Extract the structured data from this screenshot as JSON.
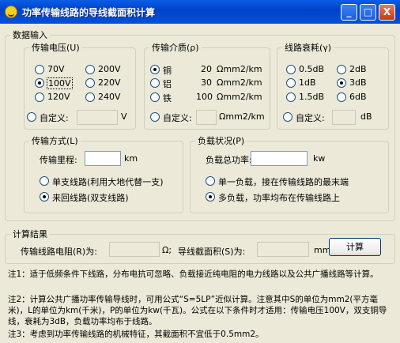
{
  "window": {
    "title": "功率传输线路的导线截面积计算",
    "minimize": "_",
    "maximize": "□",
    "close": "X"
  },
  "input_section": {
    "legend": "数据输入",
    "voltage": {
      "legend": "传输电压(U)",
      "options": [
        "70V",
        "100V",
        "120V",
        "200V",
        "220V",
        "240V"
      ],
      "selected": "100V",
      "custom_label": "自定义:",
      "custom_value": "",
      "custom_unit": "V"
    },
    "medium": {
      "legend": "传输介质(ρ)",
      "options": [
        {
          "name": "铜",
          "value": "20",
          "unit": "Ωmm2/km"
        },
        {
          "name": "铝",
          "value": "30",
          "unit": "Ωmm2/km"
        },
        {
          "name": "铁",
          "value": "100",
          "unit": "Ωmm2/km"
        }
      ],
      "selected": "铜",
      "custom_label": "自定义:",
      "custom_value": "",
      "custom_unit": "Ωmm2/km"
    },
    "attenuation": {
      "legend": "线路衰耗(γ)",
      "options": [
        "0.5dB",
        "1dB",
        "1.5dB",
        "2dB",
        "3dB",
        "6dB"
      ],
      "selected": "3dB",
      "custom_label": "自定义:",
      "custom_value": "",
      "custom_unit": "dB"
    },
    "method": {
      "legend": "传输方式(L)",
      "distance_label": "传输里程:",
      "distance_value": "",
      "distance_unit": "km",
      "options": [
        "单支线路(利用大地代替一支)",
        "来回线路(双支线路)"
      ],
      "selected": "来回线路(双支线路)"
    },
    "load": {
      "legend": "负载状况(P)",
      "power_label": "负载总功率:",
      "power_value": "",
      "power_unit": "kw",
      "options": [
        "单一负载，接在传输线路的最末端",
        "多负载，功率均布在传输线路上"
      ],
      "selected": "多负载，功率均布在传输线路上"
    }
  },
  "result_section": {
    "legend": "计算结果",
    "resistance_label": "传输线路电阻(R)为:",
    "resistance_value": "",
    "resistance_unit": "Ω;",
    "area_label": "导线截面积(S)为:",
    "area_value": "",
    "area_unit": "mm2",
    "calc_button": "计算"
  },
  "notes": [
    "注1：适于低频条件下线路，分布电抗可忽略、负载接近纯电阻的电力线路以及公共广播线路等计算。",
    "注2：计算公共广播功率传输导线时，可用公式“S=5LP”近似计算。注意其中S的单位为mm2(平方毫米)，L的单位为km(千米)，P的单位为kw(千瓦)。公式在以下条件时才适用：传输电压100V，双支铜导线，衰耗为3dB，负载功率均布于线路。",
    "注3：考虑到功率传输线路的机械特征，其截面积不宜低于0.5mm2。"
  ]
}
